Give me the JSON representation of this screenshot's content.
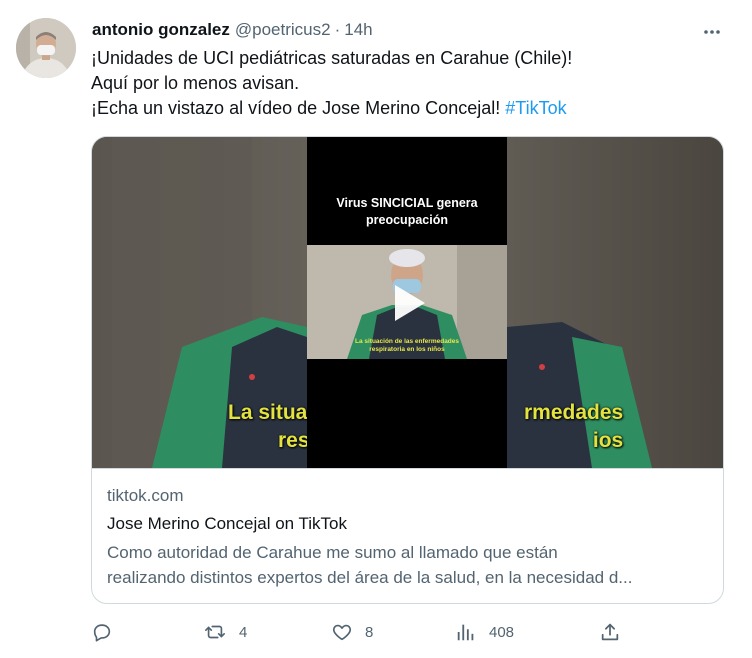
{
  "author": {
    "name": "antonio gonzalez",
    "handle": "@poetricus2",
    "separator": "·",
    "time": "14h"
  },
  "tweet": {
    "lines": [
      "¡Unidades de UCI pediátricas saturadas en Carahue (Chile)!",
      "Aquí por lo menos avisan.",
      "¡Echa un vistazo al vídeo de Jose Merino Concejal!"
    ],
    "hashtag": "#TikTok"
  },
  "card": {
    "video_heading_1": "Virus SINCICIAL genera",
    "video_heading_2": "preocupación",
    "video_caption_1": "La situación de las enfermedades",
    "video_caption_2": "respiratoria en los niños",
    "bg_caption_left_1": "La situa",
    "bg_caption_left_2": "res",
    "bg_caption_right_1": "rmedades",
    "bg_caption_right_2": "ios",
    "domain": "tiktok.com",
    "title": "Jose Merino Concejal on TikTok",
    "description_1": "Como autoridad de Carahue me sumo al llamado que están",
    "description_2": "realizando distintos expertos del área de la salud, en la necesidad d..."
  },
  "actions": {
    "replies": "",
    "retweets": "4",
    "likes": "8",
    "views": "408"
  },
  "icons": {
    "reply": "reply-icon",
    "retweet": "retweet-icon",
    "like": "heart-icon",
    "views": "views-chart-icon",
    "share": "share-icon",
    "more": "more-options-icon",
    "play": "play-icon"
  },
  "colors": {
    "text": "#0f1419",
    "secondary": "#536471",
    "link": "#1d9bf0",
    "border": "#cfd9de",
    "caption_yellow": "#e3e23f"
  }
}
